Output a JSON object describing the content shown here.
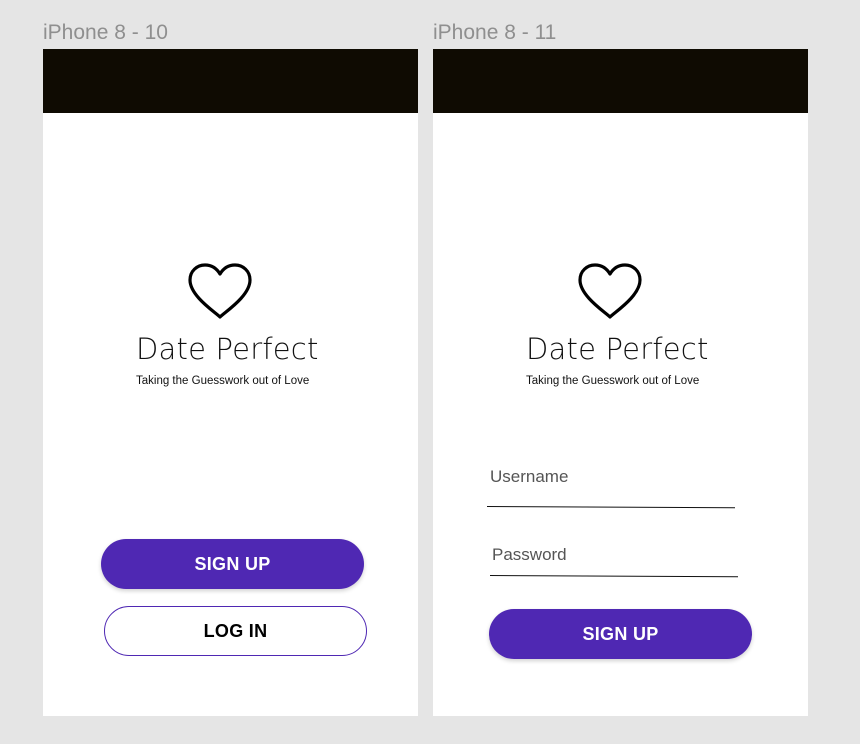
{
  "screens": [
    {
      "frame_title": "iPhone 8 - 10",
      "app_title": "Date Perfect",
      "tagline": "Taking the Guesswork out of Love",
      "sign_up_label": "SIGN UP",
      "log_in_label": "LOG IN"
    },
    {
      "frame_title": "iPhone 8 - 11",
      "app_title": "Date Perfect",
      "tagline": "Taking the Guesswork out of Love",
      "username_label": "Username",
      "password_label": "Password",
      "sign_up_label": "SIGN UP"
    }
  ],
  "colors": {
    "canvas_background": "#e5e5e5",
    "status_bar": "#0f0b02",
    "accent": "#4f28b3",
    "frame_title": "#8f8f8f"
  },
  "icons": {
    "logo": "heart-outline-icon"
  }
}
